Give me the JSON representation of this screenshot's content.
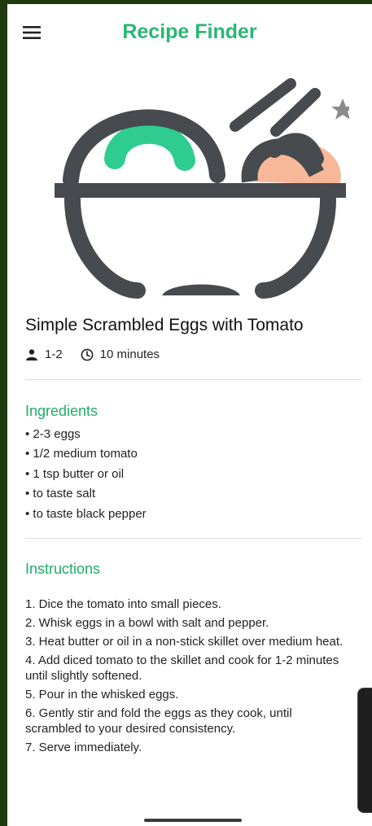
{
  "app": {
    "title": "Recipe Finder"
  },
  "recipe": {
    "title": "Simple Scrambled Eggs with Tomato",
    "servings": "1-2",
    "time": "10 minutes",
    "favorite": false
  },
  "ingredients": {
    "heading": "Ingredients",
    "items": [
      "• 2-3 eggs",
      "• 1/2 medium tomato",
      "• 1 tsp butter or oil",
      "• to taste salt",
      "• to taste black pepper"
    ]
  },
  "instructions": {
    "heading": "Instructions",
    "steps": [
      "1. Dice the tomato into small pieces.",
      "2. Whisk eggs in a bowl with salt and pepper.",
      "3. Heat butter or oil in a non-stick skillet over medium heat.",
      "4. Add diced tomato to the skillet and cook for 1-2 minutes until slightly softened.",
      "5. Pour in the whisked eggs.",
      "6. Gently stir and fold the eggs as they cook, until scrambled to your desired consistency.",
      "7. Serve immediately."
    ]
  },
  "colors": {
    "accent": "#2bb673",
    "bowl": "#474a4f",
    "egg": "#2ecc8f",
    "tomato": "#f7b899",
    "star": "#8a8a8a"
  },
  "icons": {
    "menu": "menu-icon",
    "person": "person-icon",
    "clock": "clock-icon",
    "star": "star-icon"
  }
}
